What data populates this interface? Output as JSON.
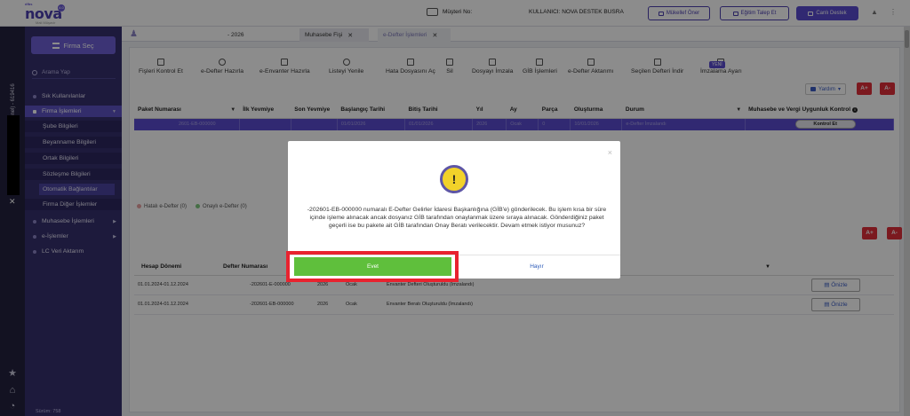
{
  "header": {
    "logo_brand": "dfbs",
    "logo_word": "nova",
    "logo_badge": "4.0",
    "logo_sub": "Mali Müşavir",
    "musteri_label": "Müşteri No:",
    "kullanici": "KULLANICI: NOVA DESTEK BUSRA",
    "mukellef_oner": "Mükellef Öner",
    "egitim_talep": "Eğitim Talep Et",
    "canli_destek": "Canlı Destek"
  },
  "strip": {
    "vertical_text": "(Genel) - 619416"
  },
  "sidebar": {
    "firma_sec": "Firma Seç",
    "search_placeholder": "Arama Yap",
    "items": [
      {
        "label": "Sık Kullanılanlar"
      },
      {
        "label": "Firma İşlemleri"
      },
      {
        "label": "Şube Bilgileri"
      },
      {
        "label": "Beyanname Bilgileri"
      },
      {
        "label": "Ortak Bilgileri"
      },
      {
        "label": "Sözleşme Bilgileri"
      },
      {
        "label": "Otomatik Bağlantılar"
      },
      {
        "label": "Firma Diğer İşlemler"
      },
      {
        "label": "Muhasebe İşlemleri"
      },
      {
        "label": "e-İşlemler"
      },
      {
        "label": "LC Veri Aktarım"
      }
    ],
    "version": "Sürüm: 758"
  },
  "tabs": [
    {
      "label": "- 2026"
    },
    {
      "label": "Muhasebe Fişi"
    },
    {
      "label": "e-Defter İşlemleri"
    }
  ],
  "toolbar": [
    {
      "label": "Fişleri Kontrol Et"
    },
    {
      "label": "e-Defter Hazırla"
    },
    {
      "label": "e-Envanter Hazırla"
    },
    {
      "label": "Listeyi Yenile"
    },
    {
      "label": "Hata Dosyasını Aç"
    },
    {
      "label": "Sil"
    },
    {
      "label": "Dosyayı İmzala"
    },
    {
      "label": "GİB İşlemleri"
    },
    {
      "label": "e-Defter Aktarımı"
    },
    {
      "label": "Seçilen Defteri İndir"
    },
    {
      "label": "İmzalama Ayarı"
    }
  ],
  "yeni_badge": "YENİ",
  "yardim": "Yardım",
  "font_plus": "A+",
  "font_minus": "A-",
  "grid1": {
    "headers": [
      "Paket Numarası",
      "İlk Yevmiye",
      "Son Yevmiye",
      "Başlangıç Tarihi",
      "Bitiş Tarihi",
      "Yıl",
      "Ay",
      "Parça",
      "Oluşturma",
      "Durum",
      "Muhasebe ve Vergi Uygunluk Kontrol"
    ],
    "row": [
      "2601-EB-000000",
      "",
      "",
      "01/01/2026",
      "01/01/2026",
      "2026",
      "Ocak",
      "0",
      "10/01/2026",
      "e-Defter İmzalandı"
    ],
    "kontrol_et": "Kontrol Et"
  },
  "legend": [
    {
      "label": "Hatalı e-Defter (0)",
      "color": "#e8a0a0"
    },
    {
      "label": "Onaylı e-Defter (0)",
      "color": "#7fc97f"
    }
  ],
  "grid2": {
    "headers": [
      "Hesap Dönemi",
      "Defter Numarası"
    ],
    "rows": [
      {
        "donem": "01.01.2024-01.12.2024",
        "numara": "-202601-E-000000",
        "yil": "2026",
        "ay": "Ocak",
        "durum": "Envanter Defteri Oluşturuldu (İmzalandı)"
      },
      {
        "donem": "01.01.2024-01.12.2024",
        "numara": "-202601-EB-000000",
        "yil": "2026",
        "ay": "Ocak",
        "durum": "Envanter Beratı Oluşturuldu (İmzalandı)"
      }
    ],
    "onizle": "Önizle"
  },
  "modal": {
    "message": "-202601-EB-000000 numaralı E-Defter Gelirler İdaresi Başkanlığına (GİB'e) gönderilecek. Bu işlem kısa bir süre içinde işleme alınacak ancak dosyanız GİB tarafından onaylanmak üzere sıraya alınacak. Gönderdiğiniz paket geçerli ise bu pakete ait GİB tarafından Onay Beratı verilecektir. Devam etmek istiyor musunuz?",
    "evet": "Evet",
    "hayir": "Hayır",
    "close": "×",
    "icon": "!"
  },
  "colors": {
    "sidebar": "#36306e",
    "accent": "#5a4cd0",
    "evet": "#5fbf3c",
    "highlight": "#e8232f",
    "warning": "#f2d22a"
  }
}
